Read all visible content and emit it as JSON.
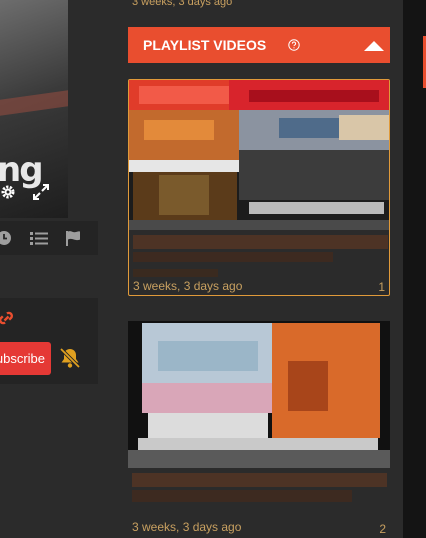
{
  "top_date": "3 weeks, 3 days ago",
  "player": {
    "logo_text": "ng",
    "settings_icon": "gear-icon",
    "fullscreen_icon": "expand-icon"
  },
  "player_toolbar": {
    "icons": [
      "clock-icon",
      "list-icon",
      "flag-icon"
    ]
  },
  "channel": {
    "link_icon": "link-icon",
    "subscribe_label": "Subscribe",
    "notifications_icon": "bell-slash-icon"
  },
  "playlist": {
    "title": "PLAYLIST VIDEOS",
    "help_icon": "question-circle-icon",
    "collapse_icon": "caret-up-icon",
    "videos": [
      {
        "date": "3 weeks, 3 days ago",
        "index": "1",
        "active": true
      },
      {
        "date": "3 weeks, 3 days ago",
        "index": "2",
        "active": false
      }
    ]
  },
  "colors": {
    "accent": "#e94e2f",
    "date_text": "#c8a060",
    "subscribe": "#e53935",
    "background": "#2b2b2b",
    "panel": "#242424"
  }
}
